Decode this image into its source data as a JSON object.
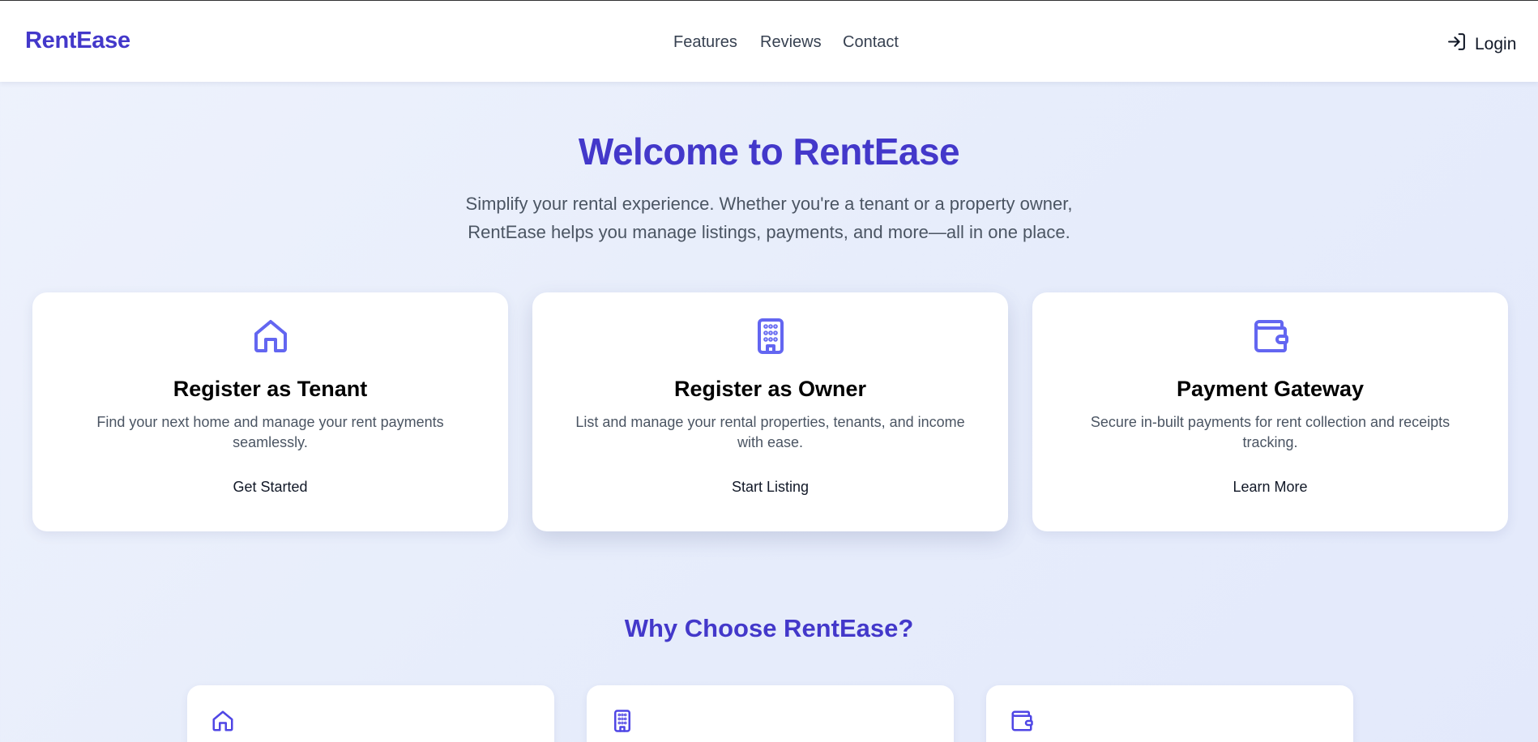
{
  "brand": "RentEase",
  "nav": [
    "Features",
    "Reviews",
    "Contact"
  ],
  "login": {
    "label": "Login",
    "icon": "login-icon"
  },
  "hero": {
    "title": "Welcome to RentEase",
    "subtitle": "Simplify your rental experience. Whether you're a tenant or a property owner, RentEase helps you manage listings, payments, and more—all in one place."
  },
  "cards": [
    {
      "icon": "home-icon",
      "title": "Register as Tenant",
      "desc": "Find your next home and manage your rent payments seamlessly.",
      "button": "Get Started"
    },
    {
      "icon": "building-icon",
      "title": "Register as Owner",
      "desc": "List and manage your rental properties, tenants, and income with ease.",
      "button": "Start Listing"
    },
    {
      "icon": "wallet-icon",
      "title": "Payment Gateway",
      "desc": "Secure in-built payments for rent collection and receipts tracking.",
      "button": "Learn More"
    }
  ],
  "why": {
    "title": "Why Choose RentEase?",
    "icons": [
      "home-icon",
      "building-icon",
      "wallet-icon"
    ]
  },
  "colors": {
    "accent": "#4338ca",
    "icon": "#6366f1"
  }
}
